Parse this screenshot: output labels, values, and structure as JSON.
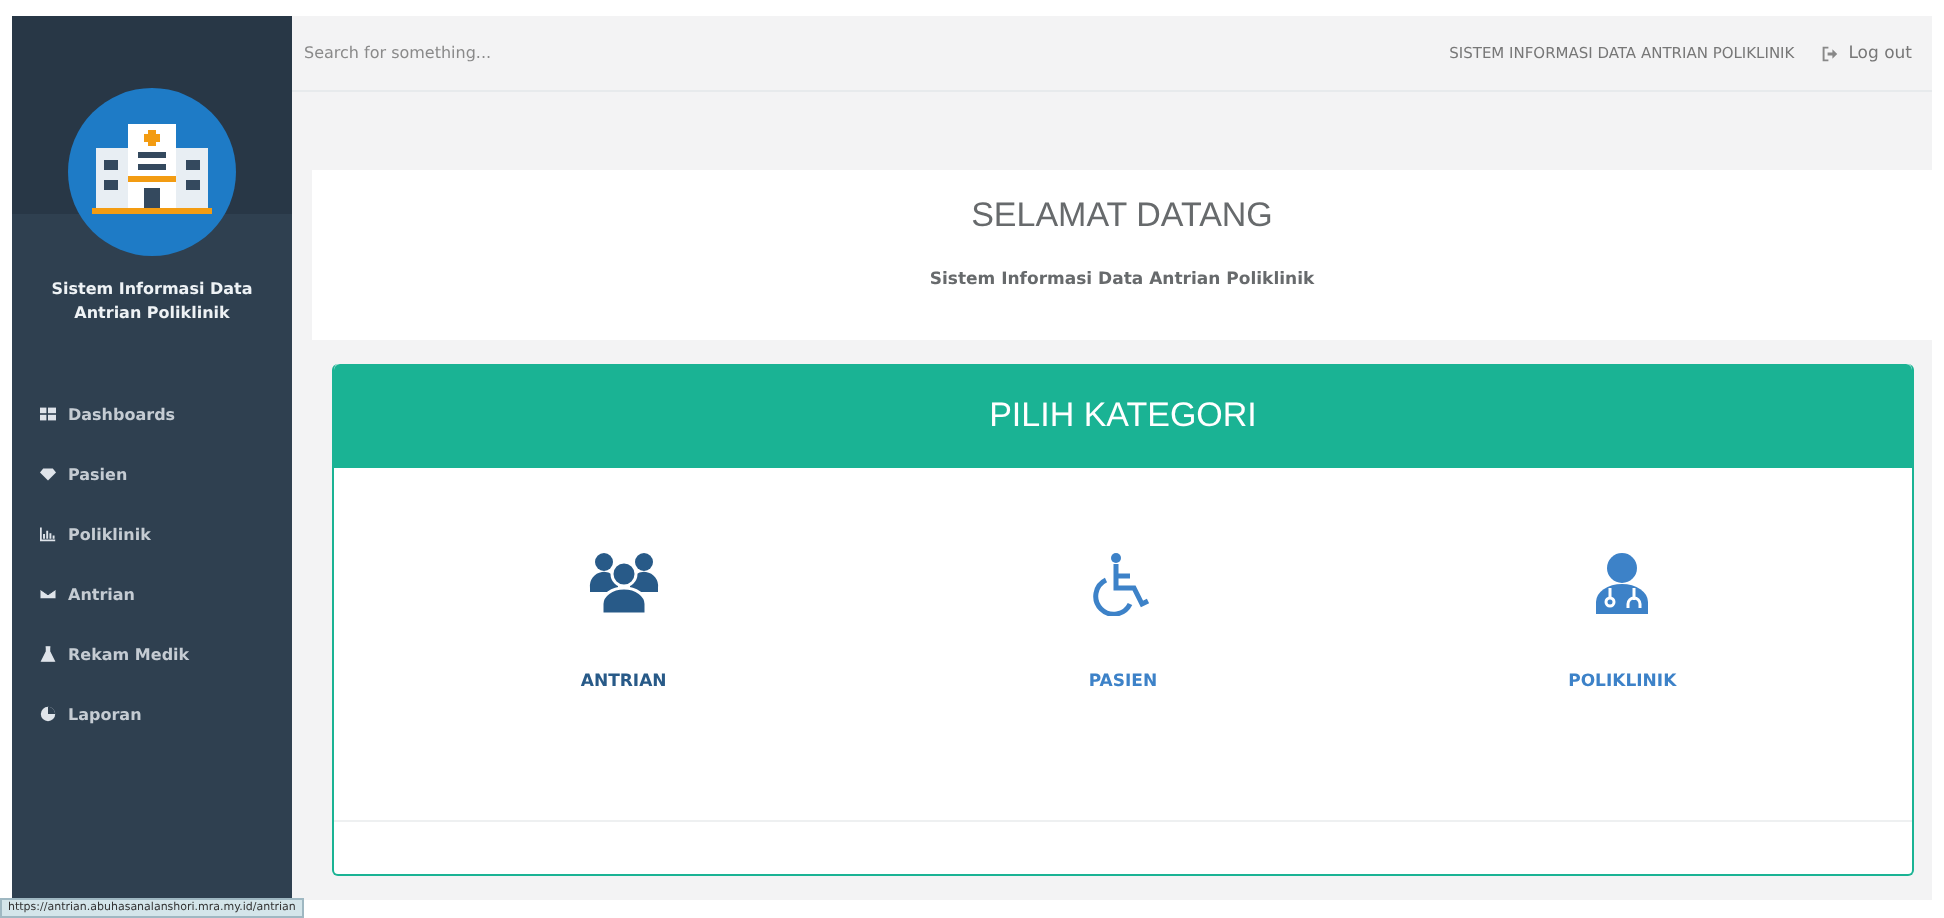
{
  "sidebar": {
    "app_title": "Sistem Informasi Data Antrian Poliklinik",
    "items": [
      {
        "label": "Dashboards"
      },
      {
        "label": "Pasien"
      },
      {
        "label": "Poliklinik"
      },
      {
        "label": "Antrian"
      },
      {
        "label": "Rekam Medik"
      },
      {
        "label": "Laporan"
      }
    ]
  },
  "header": {
    "search": {
      "placeholder": "Search for something..."
    },
    "system_name": "SISTEM INFORMASI DATA ANTRIAN POLIKLINIK",
    "logout": "Log out"
  },
  "welcome": {
    "title": "SELAMAT DATANG",
    "subtitle": "Sistem Informasi Data Antrian Poliklinik"
  },
  "categories": {
    "title": "PILIH KATEGORI",
    "items": [
      {
        "label": "ANTRIAN",
        "selected": true
      },
      {
        "label": "PASIEN",
        "selected": false
      },
      {
        "label": "POLIKLINIK",
        "selected": false
      }
    ]
  },
  "status_url": "https://antrian.abuhasanalanshori.mra.my.id/antrian"
}
